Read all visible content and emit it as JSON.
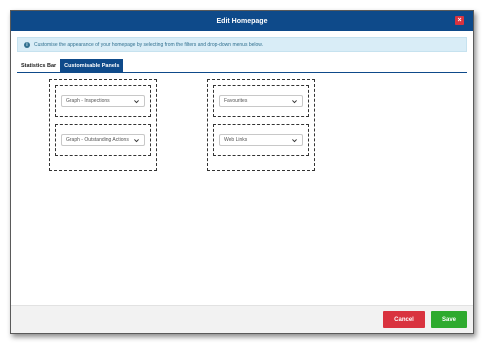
{
  "dialog": {
    "title": "Edit Homepage",
    "close_label": "×",
    "info_text": "Customise the appearance of your homepage by selecting from the filters and drop-down menus below.",
    "info_icon": "i"
  },
  "tabs": [
    {
      "label": "Statistics Bar",
      "active": false
    },
    {
      "label": "Customisable Panels",
      "active": true
    }
  ],
  "panels": {
    "left": [
      {
        "selected": "Graph - Inspections"
      },
      {
        "selected": "Graph - Outstanding Actions"
      }
    ],
    "right": [
      {
        "selected": "Favourites"
      },
      {
        "selected": "Web Links"
      }
    ]
  },
  "footer": {
    "cancel_label": "Cancel",
    "save_label": "Save"
  },
  "colors": {
    "titlebar": "#0e4a8a",
    "info_bg": "#d9edf7",
    "cancel": "#d9333f",
    "save": "#2eaa2e"
  }
}
